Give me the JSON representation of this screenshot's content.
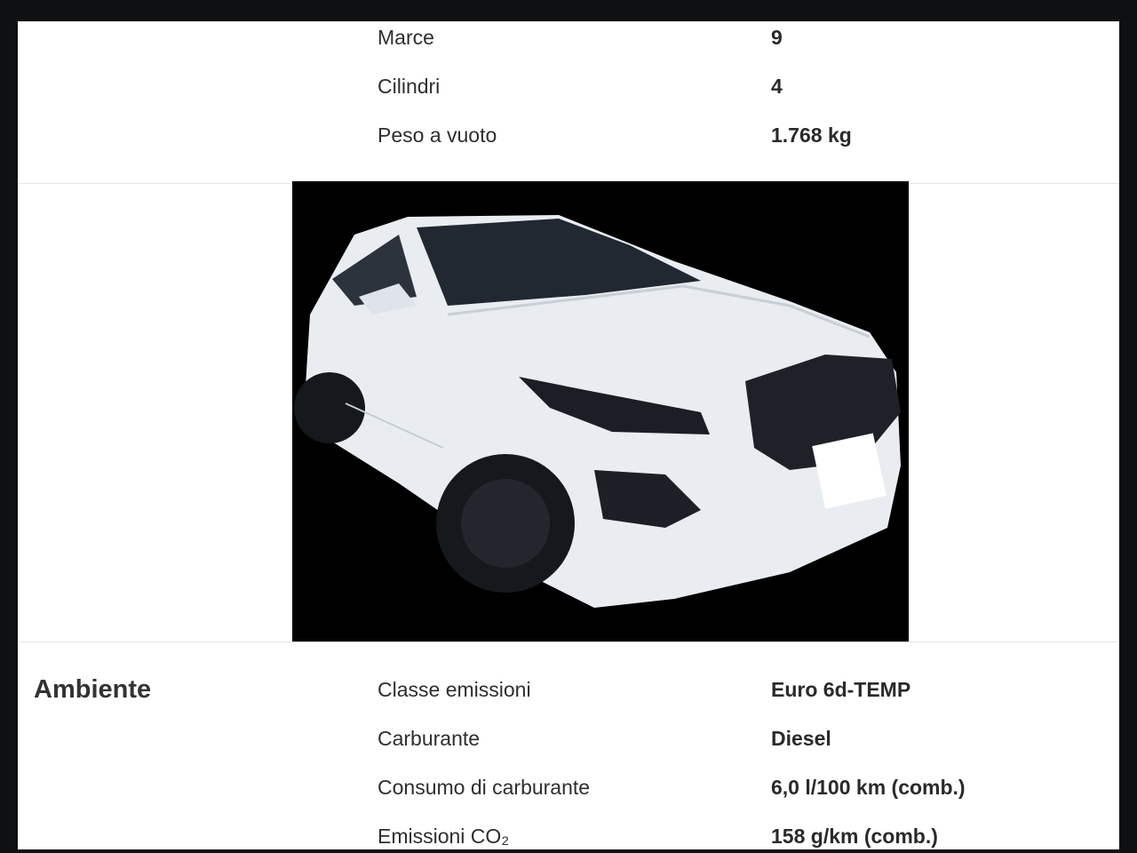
{
  "specs_top": [
    {
      "label": "Marce",
      "value": "9"
    },
    {
      "label": "Cilindri",
      "value": "4"
    },
    {
      "label": "Peso a vuoto",
      "value": "1.768 kg"
    }
  ],
  "photo": {
    "subject": "car-photo"
  },
  "ambiente": {
    "title": "Ambiente",
    "rows": [
      {
        "label": "Classe emissioni",
        "value": "Euro 6d-TEMP"
      },
      {
        "label": "Carburante",
        "value": "Diesel"
      },
      {
        "label": "Consumo di carburante",
        "value": "6,0 l/100 km (comb.)"
      },
      {
        "label": "Emissioni CO₂",
        "value": "158 g/km (comb.)"
      }
    ]
  },
  "colors": {
    "background": "#0f1012",
    "panel": "#ffffff",
    "photo_bg": "#000000"
  }
}
